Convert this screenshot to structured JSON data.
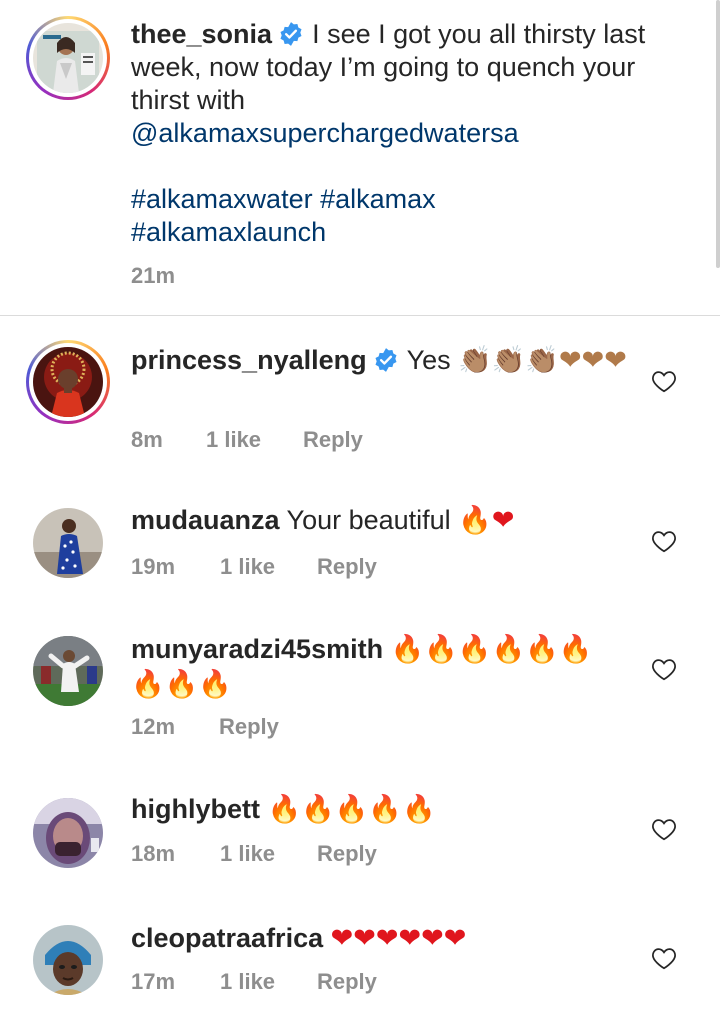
{
  "caption": {
    "username": "thee_sonia",
    "text": "I see I got you all thirsty last week, now today I’m going to quench your thirst with",
    "mention": "@alkamaxsuperchargedwatersa",
    "hashtags_line1": "#alkamaxwater #alkamax",
    "hashtags_line2": "#alkamaxlaunch",
    "time": "21m"
  },
  "comments": [
    {
      "username": "princess_nyalleng",
      "verified": true,
      "text": "Yes",
      "emoji": "👏🏽👏🏽👏🏽❤❤❤",
      "time": "8m",
      "likes": "1 like",
      "reply": "Reply"
    },
    {
      "username": "mudauanza",
      "text": "Your beautiful",
      "emoji": "🔥❤",
      "time": "19m",
      "likes": "1 like",
      "reply": "Reply"
    },
    {
      "username": "munyaradzi45smith",
      "emoji_line1": "🔥🔥🔥🔥🔥🔥",
      "emoji_line2": "🔥🔥🔥",
      "time": "12m",
      "reply": "Reply"
    },
    {
      "username": "highlybett",
      "emoji": "🔥🔥🔥🔥🔥",
      "time": "18m",
      "likes": "1 like",
      "reply": "Reply"
    },
    {
      "username": "cleopatraafrica",
      "emoji": "❤❤❤❤❤❤",
      "time": "17m",
      "likes": "1 like",
      "reply": "Reply"
    }
  ],
  "colors": {
    "text": "#262626",
    "secondary": "#8e8e8e",
    "link": "#00376b",
    "verified": "#3897f0",
    "divider": "#dbdbdb"
  },
  "icons": [
    "verified-badge-icon",
    "heart-outline-icon"
  ]
}
